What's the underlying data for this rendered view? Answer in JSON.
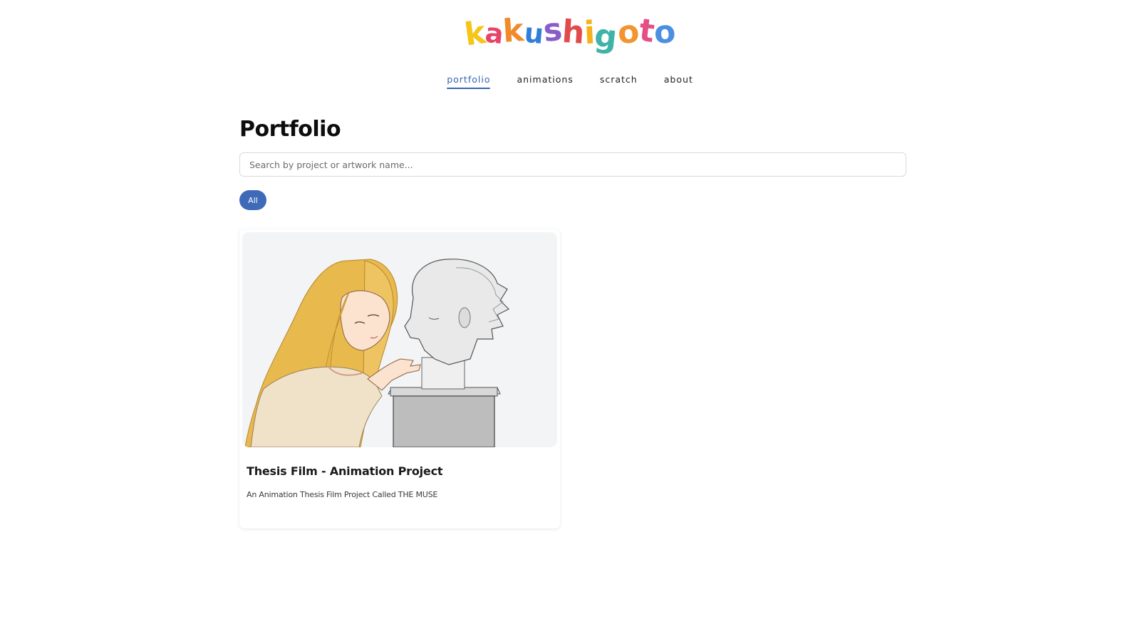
{
  "brand": {
    "logo_letters": [
      "k",
      "a",
      "k",
      "u",
      "s",
      "h",
      "i",
      "g",
      "o",
      "t",
      "o"
    ],
    "logo_colors": [
      "#f5c518",
      "#e8436a",
      "#f08a2a",
      "#2f7fd8",
      "#8a5cc8",
      "#e04b4b",
      "#f5b21d",
      "#3fb3a8",
      "#f29530",
      "#e44f86",
      "#4b8fe0"
    ]
  },
  "nav": {
    "items": [
      {
        "label": "portfolio",
        "active": true
      },
      {
        "label": "animations",
        "active": false
      },
      {
        "label": "scratch",
        "active": false
      },
      {
        "label": "about",
        "active": false
      }
    ],
    "accent_color": "#3a62b0"
  },
  "main": {
    "title": "Portfolio",
    "search": {
      "placeholder": "Search by project or artwork name...",
      "value": ""
    },
    "filters": [
      {
        "label": "All",
        "selected": true
      }
    ],
    "cards": [
      {
        "title": "Thesis Film - Animation Project",
        "description": "An Animation Thesis Film Project Called THE MUSE",
        "image_icon": "artwork-thumbnail"
      }
    ]
  }
}
